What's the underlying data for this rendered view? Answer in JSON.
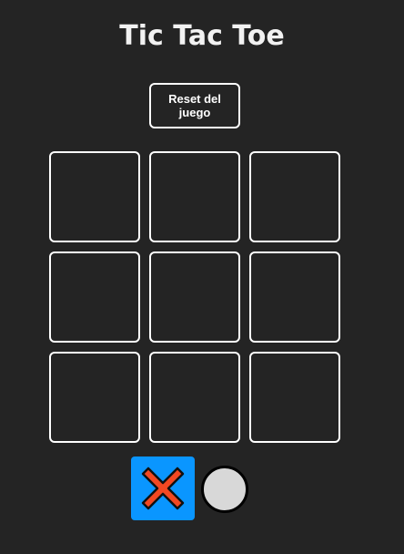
{
  "title": "Tic Tac Toe",
  "reset_button": {
    "label": "Reset del juego"
  },
  "board": {
    "cells": [
      "",
      "",
      "",
      "",
      "",
      "",
      "",
      "",
      ""
    ]
  },
  "turn": {
    "active_player": "X",
    "players": [
      {
        "symbol": "X",
        "icon": "x-mark-icon",
        "active": true
      },
      {
        "symbol": "O",
        "icon": "o-circle-icon",
        "active": false
      }
    ]
  },
  "colors": {
    "background": "#242424",
    "active_turn_highlight": "#0a96ff",
    "x_mark": "#f24822",
    "o_mark": "#d8d8d8"
  }
}
